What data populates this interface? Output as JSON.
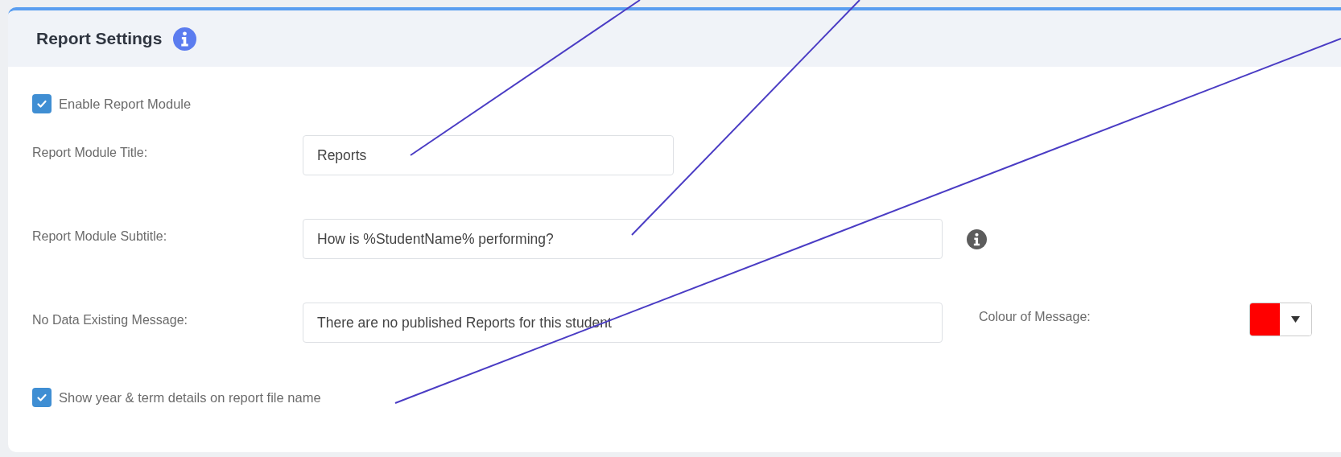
{
  "panel": {
    "title": "Report Settings"
  },
  "enable_module": {
    "label": "Enable Report Module",
    "checked": true
  },
  "fields": [
    {
      "label": "Report Module Title:",
      "value": "Reports",
      "kind": "short"
    },
    {
      "label": "Report Module Subtitle:",
      "value": "How is %StudentName% performing?",
      "kind": "info"
    },
    {
      "label": "No Data Existing Message:",
      "value": "There are no published Reports for this student",
      "kind": "colour",
      "colour_label": "Colour of Message:",
      "color": "#ff0000"
    }
  ],
  "show_term": {
    "label": "Show year & term details on report file name",
    "checked": true
  }
}
